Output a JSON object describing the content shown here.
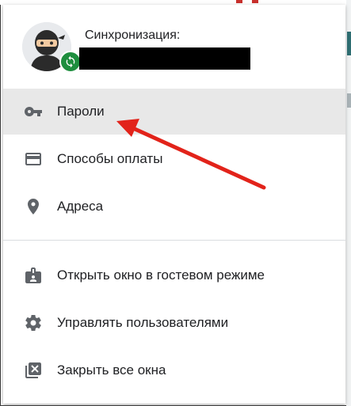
{
  "profile": {
    "sync_label": "Синхронизация:",
    "account_name_redacted": true
  },
  "menu": {
    "items": [
      {
        "label": "Пароли",
        "icon": "key-icon",
        "active": true
      },
      {
        "label": "Способы оплаты",
        "icon": "credit-card-icon",
        "active": false
      },
      {
        "label": "Адреса",
        "icon": "location-pin-icon",
        "active": false
      },
      {
        "label": "Открыть окно в гостевом режиме",
        "icon": "guest-badge-icon",
        "active": false
      },
      {
        "label": "Управлять пользователями",
        "icon": "gear-icon",
        "active": false
      },
      {
        "label": "Закрыть все окна",
        "icon": "close-windows-icon",
        "active": false
      }
    ]
  },
  "colors": {
    "active_row": "#e8e8e8",
    "sync_badge": "#1e8e3e",
    "annotation_arrow": "#e2231a",
    "icon": "#5f6368"
  }
}
